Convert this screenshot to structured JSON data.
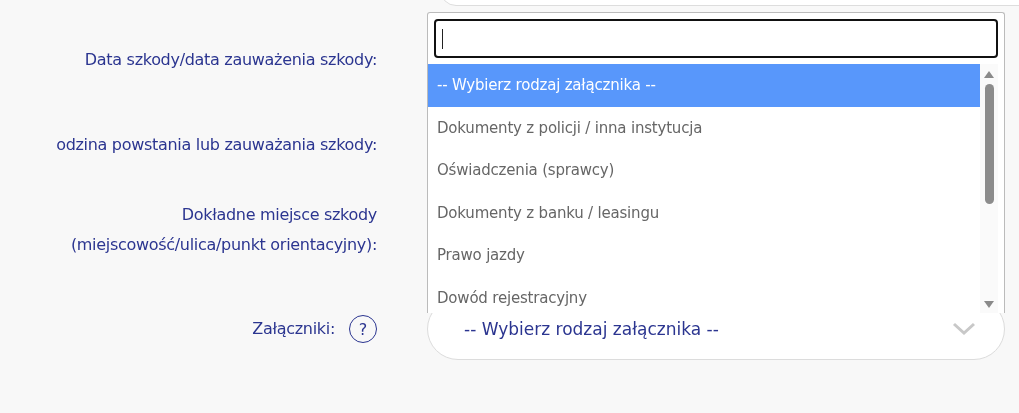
{
  "form": {
    "labels": [
      {
        "lines": [
          "Data szkody/data zauważenia szkody:"
        ]
      },
      {
        "lines": [
          "odzina powstania lub zauważania szkody:"
        ]
      },
      {
        "lines": [
          "Dokładne miejsce szkody",
          "(miejscowość/ulica/punkt orientacyjny):"
        ]
      }
    ],
    "attachments": {
      "label": "Załączniki:",
      "help": "?",
      "select": {
        "value": "-- Wybierz rodzaj załącznika --"
      }
    }
  },
  "dropdown": {
    "options": [
      {
        "label": "-- Wybierz rodzaj załącznika --",
        "selected": true
      },
      {
        "label": "Dokumenty z policji / inna instytucja",
        "selected": false
      },
      {
        "label": "Oświadczenia (sprawcy)",
        "selected": false
      },
      {
        "label": "Dokumenty z banku / leasingu",
        "selected": false
      },
      {
        "label": "Prawo jazdy",
        "selected": false
      },
      {
        "label": "Dowód rejestracyjny",
        "selected": false
      }
    ]
  }
}
